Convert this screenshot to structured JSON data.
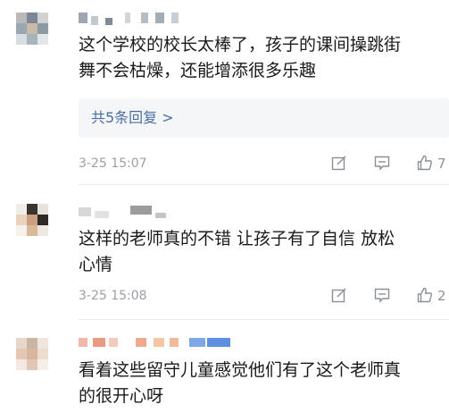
{
  "comments": [
    {
      "text_lines": [
        "这个学校的校长太棒了，孩子的课间操跳街",
        "舞不会枯燥，还能增添很多乐趣"
      ],
      "replies_label": "共5条回复 >",
      "timestamp": "3-25 15:07",
      "like_count": "7"
    },
    {
      "text_lines": [
        "这样的老师真的不错 让孩子有了自信 放松",
        "心情"
      ],
      "timestamp": "3-25 15:08",
      "like_count": "2"
    },
    {
      "text_lines": [
        "看着这些留守儿童感觉他们有了这个老师真",
        "的很开心呀"
      ]
    }
  ],
  "icons": {
    "edit": "edit-share-icon",
    "comment": "comment-icon",
    "like": "thumbs-up-icon"
  },
  "colors": {
    "link": "#4a6fa5",
    "meta": "#9aa0a6",
    "reply_bg": "#f5f6f8"
  }
}
